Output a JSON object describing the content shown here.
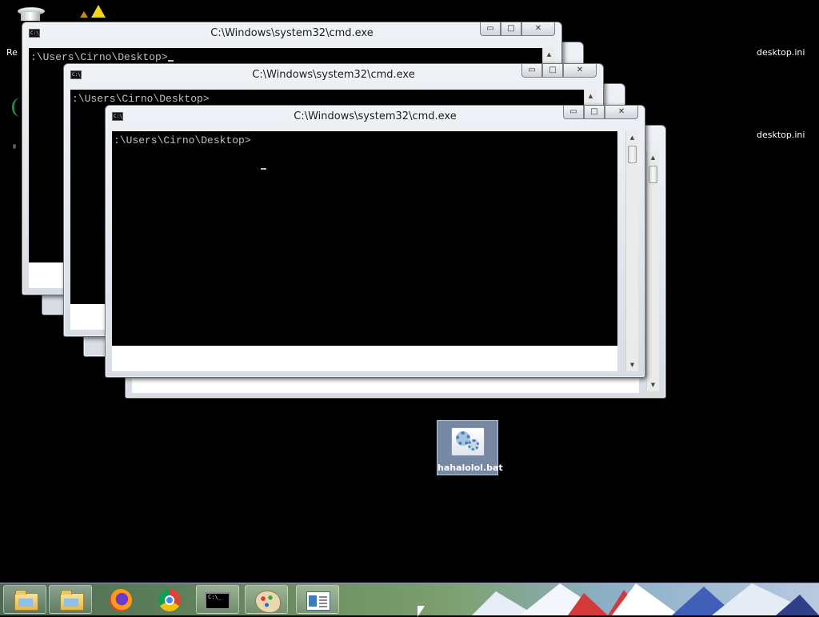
{
  "desktop": {
    "labels": {
      "desktop_ini_1": "desktop.ini",
      "desktop_ini_2": "desktop.ini",
      "partial_label": "Re"
    },
    "bat_file": {
      "label": "hahalolol.bat"
    }
  },
  "windows": [
    {
      "title": "C:\\Windows\\system32\\cmd.exe",
      "prompt": ":\\Users\\Cirno\\Desktop>"
    },
    {
      "title": "C:\\Windows\\system32\\cmd.exe",
      "prompt": ":\\Users\\Cirno\\Desktop>"
    },
    {
      "title": "C:\\Windows\\system32\\cmd.exe",
      "prompt": ":\\Users\\Cirno\\Desktop>"
    }
  ],
  "caption_buttons": {
    "minimize": "▭",
    "maximize": "□",
    "close": "✕"
  },
  "taskbar": {
    "items": [
      "folder-icon",
      "folder-icon",
      "firefox-icon",
      "chrome-icon",
      "cmd-icon",
      "paint-icon",
      "editor-icon"
    ]
  },
  "colors": {
    "console_bg": "#000000",
    "console_text": "#c0c0c0",
    "selection": "#8ca0be"
  }
}
